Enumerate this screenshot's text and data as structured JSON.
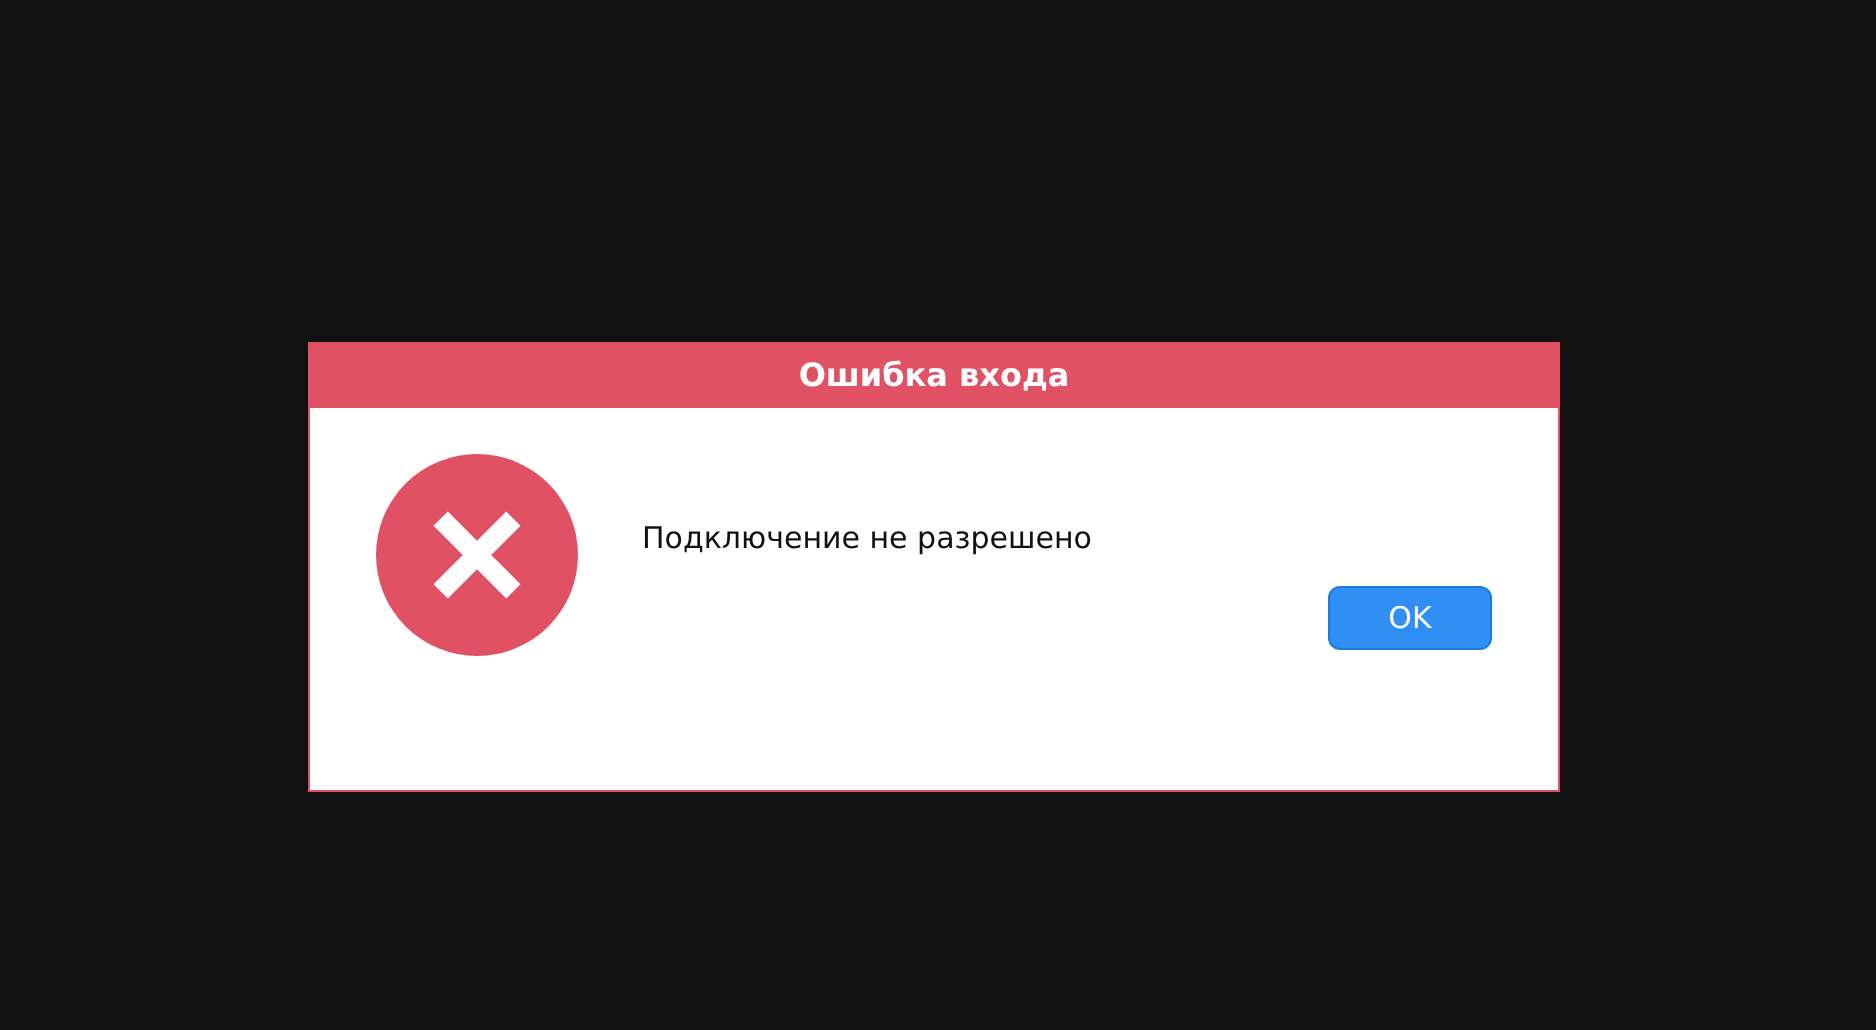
{
  "dialog": {
    "title": "Ошибка входа",
    "message": "Подключение не разрешено",
    "buttons": [
      {
        "label": "OK",
        "kind": "primary"
      }
    ]
  }
}
